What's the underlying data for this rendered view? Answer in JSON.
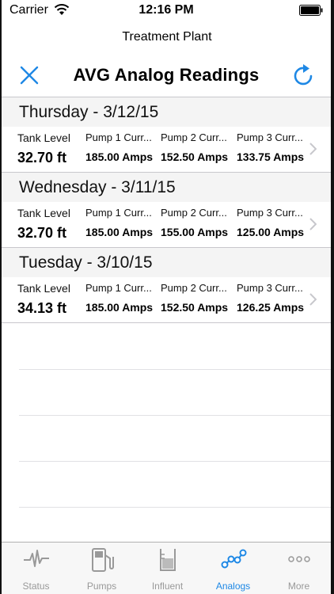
{
  "status_bar": {
    "carrier": "Carrier",
    "time": "12:16 PM"
  },
  "nav": {
    "subtitle": "Treatment Plant",
    "title": "AVG Analog Readings",
    "left_icon": "close-icon",
    "right_icon": "refresh-icon",
    "accent_color": "#1e88e5"
  },
  "sections": [
    {
      "header": "Thursday - 3/12/15",
      "columns": [
        {
          "label": "Tank Level",
          "value": "32.70 ft"
        },
        {
          "label": "Pump 1 Curr...",
          "value": "185.00 Amps"
        },
        {
          "label": "Pump 2 Curr...",
          "value": "152.50 Amps"
        },
        {
          "label": "Pump 3 Curr...",
          "value": "133.75 Amps"
        }
      ]
    },
    {
      "header": "Wednesday - 3/11/15",
      "columns": [
        {
          "label": "Tank Level",
          "value": "32.70 ft"
        },
        {
          "label": "Pump 1 Curr...",
          "value": "185.00 Amps"
        },
        {
          "label": "Pump 2 Curr...",
          "value": "155.00 Amps"
        },
        {
          "label": "Pump 3 Curr...",
          "value": "125.00 Amps"
        }
      ]
    },
    {
      "header": "Tuesday - 3/10/15",
      "columns": [
        {
          "label": "Tank Level",
          "value": "34.13 ft"
        },
        {
          "label": "Pump 1 Curr...",
          "value": "185.00 Amps"
        },
        {
          "label": "Pump 2 Curr...",
          "value": "152.50 Amps"
        },
        {
          "label": "Pump 3 Curr...",
          "value": "126.25 Amps"
        }
      ]
    }
  ],
  "tabs": [
    {
      "label": "Status",
      "icon": "pulse-icon",
      "active": false
    },
    {
      "label": "Pumps",
      "icon": "gas-pump-icon",
      "active": false
    },
    {
      "label": "Influent",
      "icon": "beaker-icon",
      "active": false
    },
    {
      "label": "Analogs",
      "icon": "analog-chain-icon",
      "active": true
    },
    {
      "label": "More",
      "icon": "more-dots-icon",
      "active": false
    }
  ]
}
